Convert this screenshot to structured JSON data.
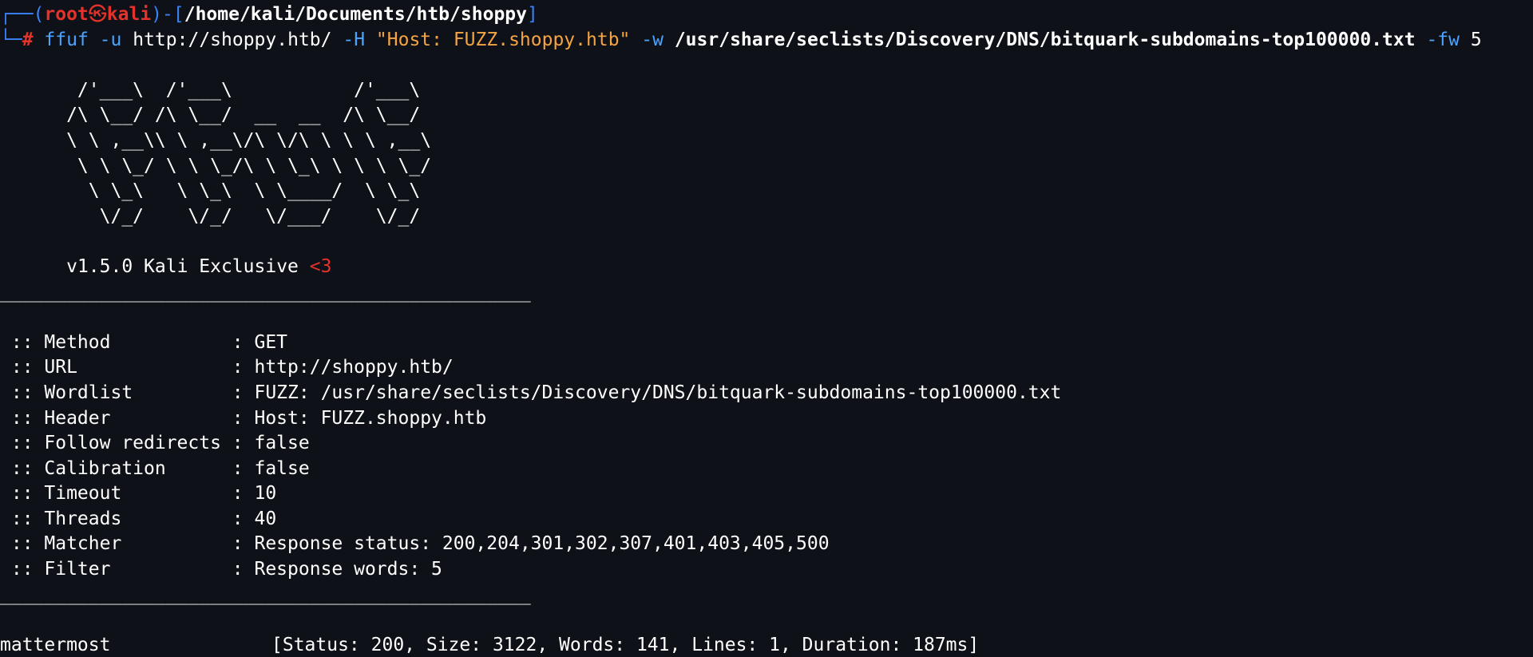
{
  "prompt": {
    "corner_top": "┌──(",
    "user": "root",
    "skull": "㉿",
    "host": "kali",
    "sep": ")-[",
    "path": "/home/kali/Documents/htb/shoppy",
    "close": "]",
    "corner_bottom": "└─",
    "hash": "#"
  },
  "command": {
    "name": "ffuf",
    "flag_u": "-u",
    "url": "http://shoppy.htb/",
    "flag_h": "-H",
    "header": "\"Host: FUZZ.shoppy.htb\"",
    "flag_w": "-w",
    "wordlist": "/usr/share/seclists/Discovery/DNS/bitquark-subdomains-top100000.txt",
    "flag_fw": "-fw",
    "fw_value": "5"
  },
  "banner": {
    "ascii": "       /'___\\  /'___\\           /'___\\       \n      /\\ \\__/ /\\ \\__/  __  __  /\\ \\__/       \n      \\ \\ ,__\\\\ \\ ,__\\/\\ \\/\\ \\ \\ \\ ,__\\      \n       \\ \\ \\_/ \\ \\ \\_/\\ \\ \\_\\ \\ \\ \\ \\_/      \n        \\ \\_\\   \\ \\_\\  \\ \\____/  \\ \\_\\       \n         \\/_/    \\/_/   \\/___/    \\/_/       ",
    "version": "v1.5.0 Kali Exclusive",
    "heart": "<3"
  },
  "divider": "________________________________________________",
  "config": [
    {
      "key": " :: Method           ",
      "value": ": GET"
    },
    {
      "key": " :: URL              ",
      "value": ": http://shoppy.htb/"
    },
    {
      "key": " :: Wordlist         ",
      "value": ": FUZZ: /usr/share/seclists/Discovery/DNS/bitquark-subdomains-top100000.txt"
    },
    {
      "key": " :: Header           ",
      "value": ": Host: FUZZ.shoppy.htb"
    },
    {
      "key": " :: Follow redirects ",
      "value": ": false"
    },
    {
      "key": " :: Calibration      ",
      "value": ": false"
    },
    {
      "key": " :: Timeout          ",
      "value": ": 10"
    },
    {
      "key": " :: Threads          ",
      "value": ": 40"
    },
    {
      "key": " :: Matcher          ",
      "value": ": Response status: 200,204,301,302,307,401,403,405,500"
    },
    {
      "key": " :: Filter           ",
      "value": ": Response words: 5"
    }
  ],
  "result": {
    "name": "mattermost",
    "details": "[Status: 200, Size: 3122, Words: 141, Lines: 1, Duration: 187ms]"
  },
  "colors": {
    "background": "#0e1117",
    "prompt_blue": "#3b82f6",
    "prompt_red": "#e5322b",
    "command_blue": "#4aa3ff",
    "string_orange": "#f5a442",
    "text": "#ffffff"
  }
}
